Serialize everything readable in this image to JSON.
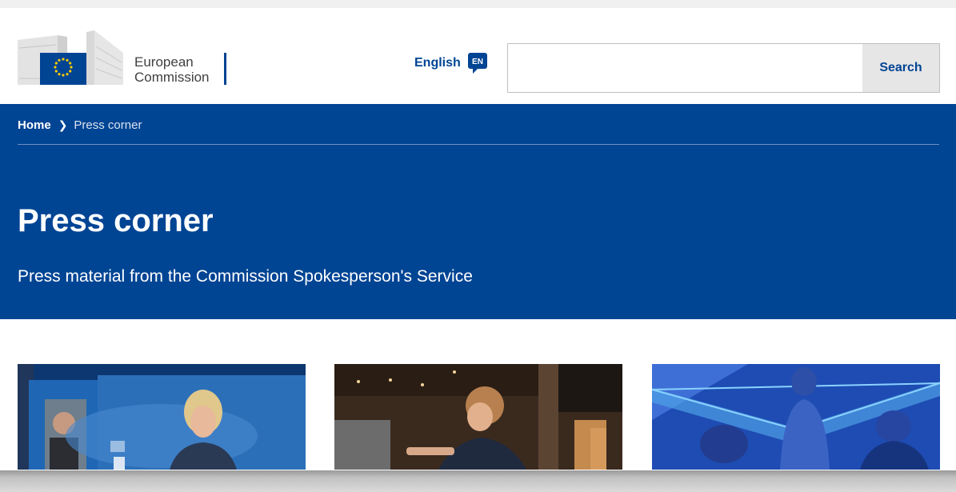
{
  "header": {
    "logo_line1": "European",
    "logo_line2": "Commission",
    "language_label": "English",
    "language_code": "EN",
    "search_placeholder": "",
    "search_button": "Search"
  },
  "breadcrumb": {
    "home": "Home",
    "current": "Press corner"
  },
  "hero": {
    "title": "Press corner",
    "subtitle": "Press material from the Commission Spokesperson's Service"
  },
  "cards": [
    {
      "image": "press-conference-photo"
    },
    {
      "image": "barista-cafe-photo"
    },
    {
      "image": "laboratory-researchers-photo"
    }
  ],
  "colors": {
    "brand_blue": "#004494",
    "eu_yellow": "#ffcc00",
    "search_button_bg": "#e6e6e6"
  }
}
